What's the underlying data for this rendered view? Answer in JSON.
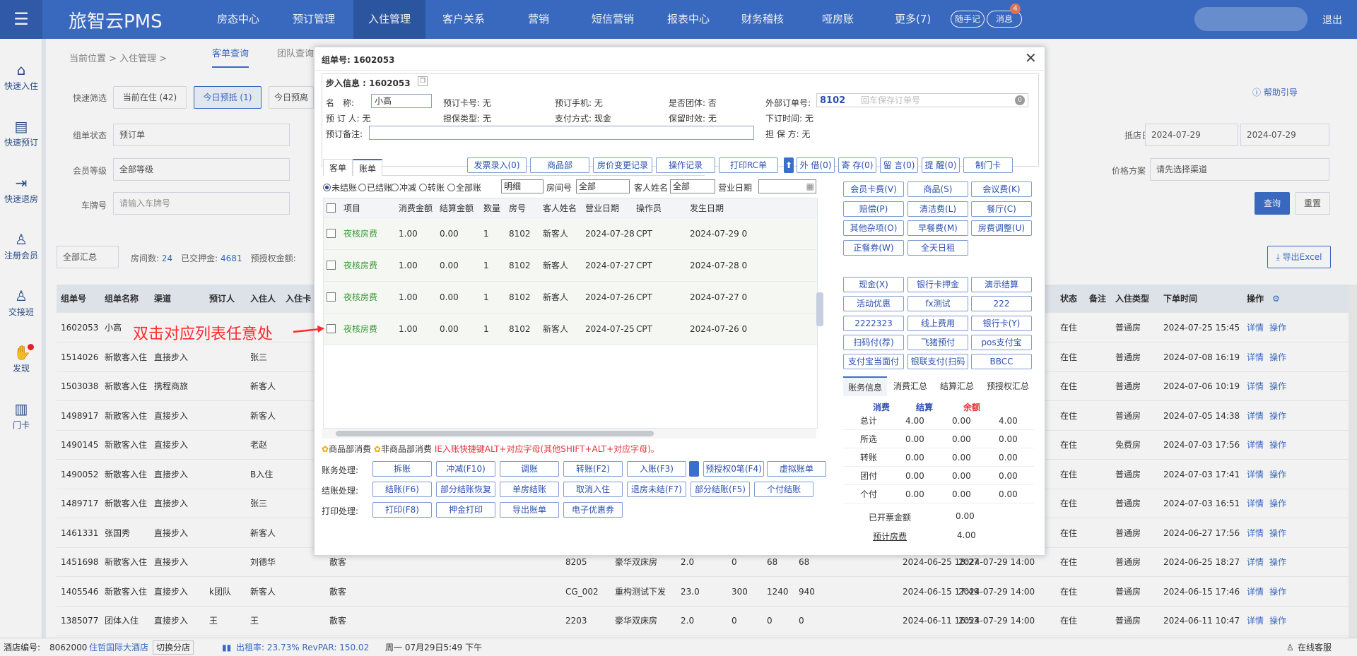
{
  "app": {
    "brand": "旅智云PMS",
    "logout": "退出"
  },
  "nav": [
    "房态中心",
    "预订管理",
    "入住管理",
    "客户关系",
    "营销",
    "短信营销",
    "报表中心",
    "财务稽核",
    "哑房账",
    "更多(7)"
  ],
  "top_actions": {
    "note": "随手记",
    "msg": "消息",
    "msg_count": "4"
  },
  "sidebar": [
    "快速入住",
    "快速预订",
    "快速退房",
    "注册会员",
    "交接班",
    "发现",
    "门卡"
  ],
  "breadcrumb": "当前位置 > 入住管理 >",
  "page_tabs": [
    "客单查询",
    "团队查询"
  ],
  "filters": {
    "quick_label": "快速筛选",
    "quick": [
      "当前在住 (42)",
      "今日预抵 (1)",
      "今日预离"
    ],
    "status_label": "组单状态",
    "status_value": "预订单",
    "member_label": "会员等级",
    "member_value": "全部等级",
    "plate_label": "车牌号",
    "plate_placeholder": "请输入车牌号",
    "arrive_label": "抵店日期",
    "arrive_from": "2024-07-29",
    "arrive_to": "2024-07-29",
    "price_label": "价格方案",
    "price_placeholder": "请先选择渠道",
    "help": "帮助引导",
    "query": "查询",
    "reset": "重置",
    "export": "导出Excel"
  },
  "summary": {
    "select": "全部汇总",
    "rooms_label": "房间数:",
    "rooms": "24",
    "deposit_label": "已交押金:",
    "deposit": "4681",
    "preauth_label": "预授权金额:"
  },
  "bg_table": {
    "headers": [
      "组单号",
      "组单名称",
      "渠道",
      "预订人",
      "入住人",
      "入住卡",
      "状态",
      "备注",
      "入住类型",
      "下单时间",
      "操作"
    ],
    "rows": [
      {
        "id": "1602053",
        "name": "小高",
        "channel": "",
        "booker": "",
        "guest": "",
        "extra": [],
        "status": "在住",
        "type": "普通房",
        "time": "2024-07-25 15:45"
      },
      {
        "id": "1514026",
        "name": "新散客入住",
        "channel": "直接步入",
        "booker": "",
        "guest": "张三",
        "extra": [],
        "status": "在住",
        "type": "普通房",
        "time": "2024-07-08 16:19"
      },
      {
        "id": "1503038",
        "name": "新散客入住",
        "channel": "携程商旅",
        "booker": "",
        "guest": "新客人",
        "extra": [],
        "status": "在住",
        "type": "普通房",
        "time": "2024-07-06 10:19"
      },
      {
        "id": "1498917",
        "name": "新散客入住",
        "channel": "直接步入",
        "booker": "",
        "guest": "新客人",
        "extra": [],
        "status": "在住",
        "type": "普通房",
        "time": "2024-07-05 14:38"
      },
      {
        "id": "1490145",
        "name": "新散客入住",
        "channel": "直接步入",
        "booker": "",
        "guest": "老赵",
        "extra": [],
        "status": "在住",
        "type": "免费房",
        "time": "2024-07-03 17:56"
      },
      {
        "id": "1490052",
        "name": "新散客入住",
        "channel": "直接步入",
        "booker": "",
        "guest": "B入住",
        "extra": [],
        "status": "在住",
        "type": "普通房",
        "time": "2024-07-03 17:41"
      },
      {
        "id": "1489717",
        "name": "新散客入住",
        "channel": "直接步入",
        "booker": "",
        "guest": "张三",
        "extra": [],
        "status": "在住",
        "type": "普通房",
        "time": "2024-07-03 16:51"
      },
      {
        "id": "1461331",
        "name": "张国秀",
        "channel": "直接步入",
        "booker": "",
        "guest": "新客人",
        "extra": [],
        "status": "在住",
        "type": "普通房",
        "time": "2024-06-27 17:56"
      },
      {
        "id": "1451698",
        "name": "新散客入住",
        "channel": "直接步入",
        "booker": "",
        "guest": "刘德华",
        "extra": [
          "散客",
          "8205",
          "豪华双床房",
          "2.0",
          "0",
          "68",
          "68",
          "2024-06-25 18:27",
          "2024-07-29 14:00"
        ],
        "status": "在住",
        "type": "普通房",
        "time": "2024-06-25 18:27"
      },
      {
        "id": "1405546",
        "name": "新散客入住",
        "channel": "直接步入",
        "booker": "k团队",
        "guest": "新客人",
        "extra": [
          "散客",
          "CG_002",
          "重构测试下发",
          "23.0",
          "300",
          "1240",
          "940",
          "2024-06-15 17:49",
          "2024-07-29 14:00"
        ],
        "status": "在住",
        "type": "普通房",
        "time": "2024-06-15 17:46"
      },
      {
        "id": "1385077",
        "name": "团体入住",
        "channel": "直接步入",
        "booker": "王",
        "guest": "王",
        "extra": [
          "散客",
          "2203",
          "豪华双床房",
          "2.0",
          "0",
          "0",
          "0",
          "2024-06-11 16:53",
          "2024-07-29 14:00"
        ],
        "status": "在住",
        "type": "普通房",
        "time": "2024-06-11 10:47"
      }
    ],
    "ops": [
      "详情",
      "操作"
    ]
  },
  "statusbar": {
    "hotel_label": "酒店编号:",
    "hotel_no": "8062000",
    "hotel_name": "住哲国际大酒店",
    "switch": "切换分店",
    "occupancy": "出租率: 23.73% RevPAR: 150.02",
    "datetime": "周一 07月29日5:49 下午",
    "support": "在线客服"
  },
  "dialog": {
    "title": "组单号: 1602053",
    "info_title": "步入信息 : 1602053",
    "name_label": "名　称:",
    "name_value": "小高",
    "card_no": "预订卡号: 无",
    "phone": "预订手机: 无",
    "is_group": "是否团体: 否",
    "ext_label": "外部订单号:",
    "ext_value": "8102",
    "ext_placeholder": "回车保存订单号",
    "ext_badge": "0",
    "booker": "预 订 人: 无",
    "guarantee_type": "担保类型: 无",
    "pay_method": "支付方式: 现金",
    "hold": "保留时效: 无",
    "order_time": "下订时间: 无",
    "remark_label": "预订备注:",
    "guarantor": "担 保 方: 无",
    "tabs": [
      "客单",
      "账单"
    ],
    "top_buttons": [
      "发票录入(0)",
      "商品部",
      "房价变更记录",
      "操作记录",
      "打印RC单",
      "外 借(0)",
      "寄 存(0)",
      "留 言(0)",
      "提 醒(0)",
      "制门卡"
    ],
    "radios": [
      "未结账",
      "已结账",
      "冲减",
      "转账",
      "全部账"
    ],
    "detail_select": "明细",
    "room_label": "房间号",
    "room_select": "全部",
    "guest_label": "客人姓名",
    "guest_select": "全部",
    "bizdate_label": "营业日期",
    "grid_headers": [
      "项目",
      "消费金额",
      "结算金额",
      "数量",
      "房号",
      "客人姓名",
      "营业日期",
      "操作员",
      "发生日期"
    ],
    "grid_rows": [
      [
        "夜核房费",
        "1.00",
        "0.00",
        "1",
        "8102",
        "新客人",
        "2024-07-28",
        "CPT",
        "2024-07-29 0"
      ],
      [
        "夜核房费",
        "1.00",
        "0.00",
        "1",
        "8102",
        "新客人",
        "2024-07-27",
        "CPT",
        "2024-07-28 0"
      ],
      [
        "夜核房费",
        "1.00",
        "0.00",
        "1",
        "8102",
        "新客人",
        "2024-07-26",
        "CPT",
        "2024-07-27 0"
      ],
      [
        "夜核房费",
        "1.00",
        "0.00",
        "1",
        "8102",
        "新客人",
        "2024-07-25",
        "CPT",
        "2024-07-26 0"
      ]
    ],
    "consume_buttons": [
      "会员卡费(V)",
      "商品(S)",
      "会议费(K)",
      "赔偿(P)",
      "清洁费(L)",
      "餐厅(C)",
      "其他杂项(O)",
      "早餐费(M)",
      "房费调整(U)",
      "正餐券(W)",
      "全天日租"
    ],
    "pay_buttons": [
      "现金(X)",
      "银行卡押金",
      "演示结算",
      "活动优惠",
      "fx测试",
      "222",
      "2222323",
      "线上费用",
      "银行卡(Y)",
      "扫码付(荐)",
      "飞猪预付",
      "pos支付宝",
      "支付宝当面付",
      "银联支付(扫码",
      "BBCC"
    ],
    "summary_tabs": [
      "账务信息",
      "消费汇总",
      "结算汇总",
      "预授权汇总"
    ],
    "summary_headers": [
      "消费",
      "结算",
      "余额"
    ],
    "summary_rows": [
      [
        "总计",
        "4.00",
        "0.00",
        "4.00"
      ],
      [
        "所选",
        "0.00",
        "0.00",
        "0.00"
      ],
      [
        "转账",
        "0.00",
        "0.00",
        "0.00"
      ],
      [
        "团付",
        "0.00",
        "0.00",
        "0.00"
      ],
      [
        "个付",
        "0.00",
        "0.00",
        "0.00"
      ]
    ],
    "invoiced_label": "已开票金额",
    "invoiced_value": "0.00",
    "est_label": "预计房费",
    "est_value": "4.00",
    "legend_goods": "商品部消费",
    "legend_nongoods": "非商品部消费",
    "legend_hint": "IE入账快捷键ALT+对应字母(其他SHIFT+ALT+对应字母)。",
    "acct_label": "账务处理:",
    "acct_buttons": [
      "拆账",
      "冲减(F10)",
      "调账",
      "转账(F2)",
      "入账(F3)",
      "预授权0笔(F4)",
      "虚拟账单"
    ],
    "settle_label": "结账处理:",
    "settle_buttons": [
      "结账(F6)",
      "部分结账恢复",
      "单房结账",
      "取消入住",
      "退房未结(F7)",
      "部分结账(F5)",
      "个付结账"
    ],
    "print_label": "打印处理:",
    "print_buttons": [
      "打印(F8)",
      "押金打印",
      "导出账单",
      "电子优惠券"
    ]
  },
  "annotation": "双击对应列表任意处"
}
